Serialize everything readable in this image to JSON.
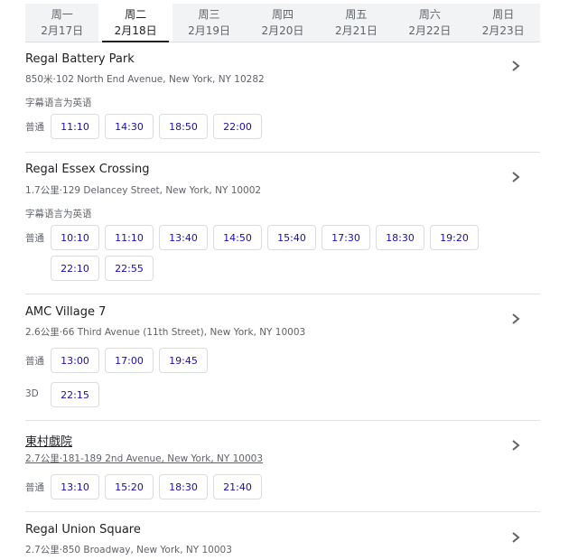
{
  "days": [
    {
      "name": "周一",
      "date": "2月17日"
    },
    {
      "name": "周二",
      "date": "2月18日"
    },
    {
      "name": "周三",
      "date": "2月19日"
    },
    {
      "name": "周四",
      "date": "2月20日"
    },
    {
      "name": "周五",
      "date": "2月21日"
    },
    {
      "name": "周六",
      "date": "2月22日"
    },
    {
      "name": "周日",
      "date": "2月23日"
    }
  ],
  "active_day": "周二",
  "subtitle_note": "字幕语言为英语",
  "theaters": [
    {
      "name": "Regal Battery Park",
      "address": "850米·102 North End Avenue, New York, NY 10282",
      "subtitle": "字幕语言为英语",
      "formats": [
        {
          "label": "普通",
          "times": [
            "11:10",
            "14:30",
            "18:50",
            "22:00"
          ]
        }
      ]
    },
    {
      "name": "Regal Essex Crossing",
      "address": "1.7公里·129 Delancey Street, New York, NY 10002",
      "subtitle": "字幕语言为英语",
      "formats": [
        {
          "label": "普通",
          "times": [
            "10:10",
            "11:10",
            "13:40",
            "14:50",
            "15:40",
            "17:30",
            "18:30",
            "19:20",
            "22:10",
            "22:55"
          ]
        }
      ]
    },
    {
      "name": "AMC Village 7",
      "address": "2.6公里·66 Third Avenue (11th Street), New York, NY 10003",
      "formats": [
        {
          "label": "普通",
          "times": [
            "13:00",
            "17:00",
            "19:45"
          ]
        },
        {
          "label": "3D",
          "times": [
            "22:15"
          ]
        }
      ]
    },
    {
      "name": "東村戲院",
      "address": "2.7公里·181-189 2nd Avenue, New York, NY 10003",
      "formats": [
        {
          "label": "普通",
          "times": [
            "13:10",
            "15:20",
            "18:30",
            "21:40"
          ]
        }
      ]
    },
    {
      "name": "Regal Union Square",
      "address": "2.7公里·850 Broadway, New York, NY 10003",
      "formats": []
    }
  ]
}
